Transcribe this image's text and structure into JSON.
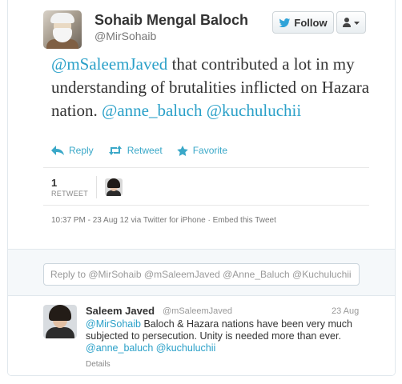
{
  "tweet": {
    "author_name": "Sohaib Mengal Baloch",
    "author_handle": "@MirSohaib",
    "follow_label": "Follow",
    "text_parts": {
      "mention1": "@mSaleemJaved",
      "body": " that contributed a lot in my understanding of brutalities inflicted on Hazara nation. ",
      "mention2": "@anne_baluch",
      "mention3": "@kuchuluchii"
    },
    "actions": {
      "reply": "Reply",
      "retweet": "Retweet",
      "favorite": "Favorite"
    },
    "retweet_count": "1",
    "retweet_label": "RETWEET",
    "meta": "10:37 PM - 23 Aug 12 via Twitter for iPhone · Embed this Tweet"
  },
  "reply_box": {
    "placeholder": "Reply to @MirSohaib @mSaleemJaved @Anne_Baluch @Kuchuluchii"
  },
  "reply": {
    "name": "Saleem Javed",
    "handle": "@mSaleemJaved",
    "date": "23 Aug",
    "mention1": "@MirSohaib",
    "body": " Baloch & Hazara nations have been very much subjected to persecution. Unity is needed more than ever. ",
    "mention2": "@anne_baluch",
    "mention3": "@kuchuluchii",
    "details": "Details"
  },
  "colors": {
    "link": "#2aa0c8",
    "action": "#3aa8c8"
  },
  "icons": {
    "follow": "twitter-bird-icon",
    "user_menu": "user-dropdown-icon",
    "reply": "reply-arrow-icon",
    "retweet": "retweet-icon",
    "favorite": "star-icon"
  }
}
